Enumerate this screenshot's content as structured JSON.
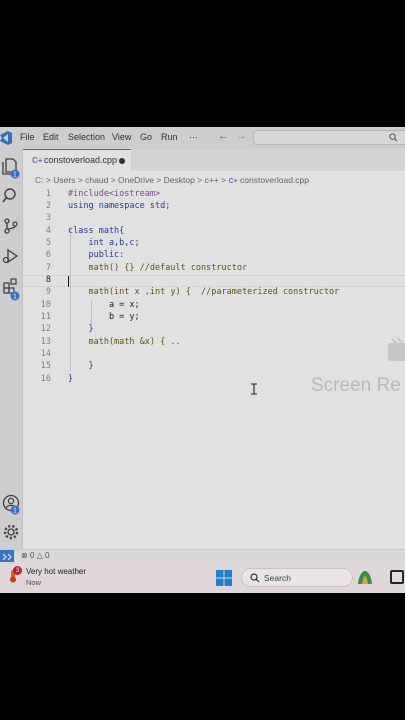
{
  "menu": {
    "items": [
      "File",
      "Edit",
      "Selection",
      "View",
      "Go",
      "Run"
    ],
    "more": "···"
  },
  "nav": {
    "back": "←",
    "forward": "→"
  },
  "tab": {
    "filename": "constoverload.cpp",
    "icon_text": "C+"
  },
  "breadcrumb": {
    "parts": [
      "C:",
      "Users",
      "chaud",
      "OneDrive",
      "Desktop",
      "c++"
    ],
    "separator": ">",
    "file": "constoverload.cpp"
  },
  "editor": {
    "line_numbers": [
      "1",
      "2",
      "3",
      "4",
      "5",
      "6",
      "7",
      "8",
      "9",
      "10",
      "11",
      "12",
      "13",
      "14",
      "15",
      "16"
    ],
    "active_line": "8",
    "lines": [
      "#include<iostream>",
      "using namespace std;",
      "",
      "class math{",
      "    int a,b,c;",
      "    public:",
      "    math() {} //default constructor",
      "",
      "    math(int x ,int y) {  //parameterized constructor",
      "        a = x;",
      "        b = y;",
      "    }",
      "    math(math &x) { ..",
      "",
      "    }",
      "}"
    ]
  },
  "watermark": "Screen Re",
  "status": {
    "errors": "0",
    "warnings": "0",
    "remote_icon": "remote-icon"
  },
  "taskbar": {
    "weather_title": "Very hot weather",
    "weather_subtitle": "Now",
    "weather_badge": "3",
    "search_label": "Search"
  },
  "colors": {
    "accent": "#3c7bd6",
    "keyword": "#2c3ea8",
    "comment": "#3b6e2a",
    "preprocessor": "#8b4a9c"
  }
}
